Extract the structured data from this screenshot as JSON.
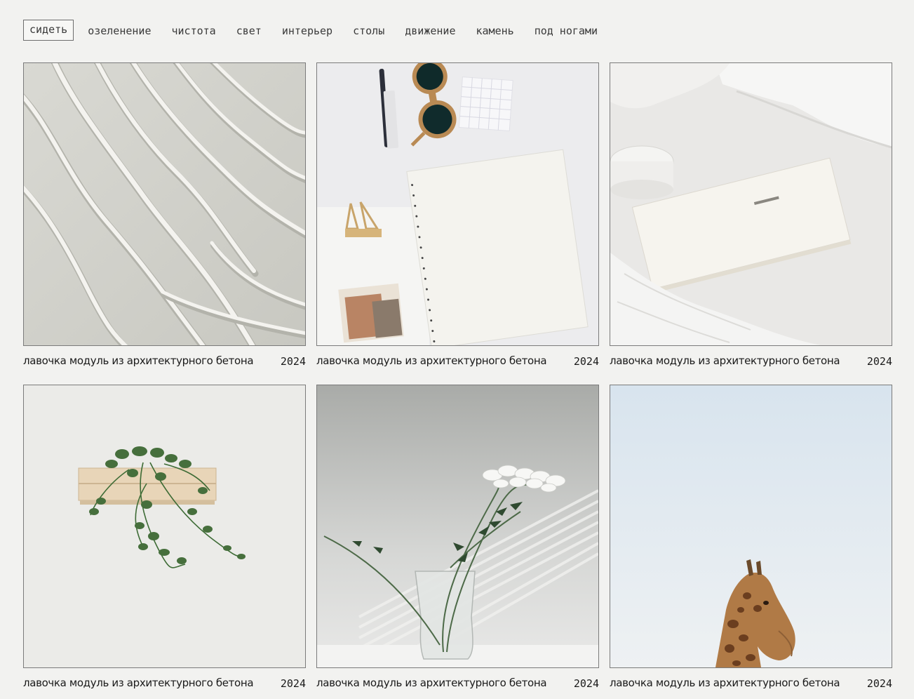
{
  "nav": {
    "items": [
      {
        "label": "сидеть",
        "active": true
      },
      {
        "label": "озеленение",
        "active": false
      },
      {
        "label": "чистота",
        "active": false
      },
      {
        "label": "свет",
        "active": false
      },
      {
        "label": "интерьер",
        "active": false
      },
      {
        "label": "столы",
        "active": false
      },
      {
        "label": "движение",
        "active": false
      },
      {
        "label": "камень",
        "active": false
      },
      {
        "label": "под ногами",
        "active": false
      }
    ]
  },
  "gallery": {
    "cards": [
      {
        "image": "sand-dunes-photo",
        "title": "лавочка модуль из архитектурного бетона",
        "year": "2024"
      },
      {
        "image": "desk-flatlay-photo",
        "title": "лавочка модуль из архитектурного бетона",
        "year": "2024"
      },
      {
        "image": "notebook-on-bed-photo",
        "title": "лавочка модуль из архитектурного бетона",
        "year": "2024"
      },
      {
        "image": "ivy-wooden-shelf-photo",
        "title": "лавочка модуль из архитектурного бетона",
        "year": "2024"
      },
      {
        "image": "flowers-glass-vase-photo",
        "title": "лавочка модуль из архитектурного бетона",
        "year": "2024"
      },
      {
        "image": "giraffe-sky-photo",
        "title": "лавочка модуль из архитектурного бетона",
        "year": "2024"
      }
    ]
  },
  "colors": {
    "background": "#f2f2f0",
    "text": "#1a1a1a",
    "border": "#7b7b7b"
  }
}
